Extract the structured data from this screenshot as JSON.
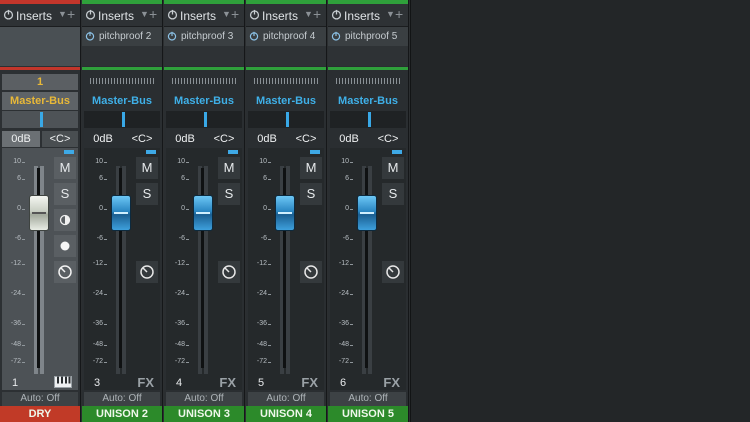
{
  "inserts_label": "Inserts",
  "channels": [
    {
      "insert_plugin": "",
      "channel_number_badge": "1",
      "bus": "Master-Bus",
      "volume": "0dB",
      "pan": "<C>",
      "mute": "M",
      "solo": "S",
      "channel_index": "1",
      "automation": "Auto: Off",
      "name": "DRY",
      "color": "#c13a27"
    },
    {
      "insert_plugin": "pitchproof 2",
      "bus": "Master-Bus",
      "volume": "0dB",
      "pan": "<C>",
      "mute": "M",
      "solo": "S",
      "channel_index": "3",
      "fx": "FX",
      "automation": "Auto: Off",
      "name": "UNISON 2",
      "color": "#2c8a2a"
    },
    {
      "insert_plugin": "pitchproof 3",
      "bus": "Master-Bus",
      "volume": "0dB",
      "pan": "<C>",
      "mute": "M",
      "solo": "S",
      "channel_index": "4",
      "fx": "FX",
      "automation": "Auto: Off",
      "name": "UNISON 3",
      "color": "#2c8a2a"
    },
    {
      "insert_plugin": "pitchproof 4",
      "bus": "Master-Bus",
      "volume": "0dB",
      "pan": "<C>",
      "mute": "M",
      "solo": "S",
      "channel_index": "5",
      "fx": "FX",
      "automation": "Auto: Off",
      "name": "UNISON 4",
      "color": "#2c8a2a"
    },
    {
      "insert_plugin": "pitchproof 5",
      "bus": "Master-Bus",
      "volume": "0dB",
      "pan": "<C>",
      "mute": "M",
      "solo": "S",
      "channel_index": "6",
      "fx": "FX",
      "automation": "Auto: Off",
      "name": "UNISON 5",
      "color": "#2c8a2a"
    }
  ],
  "meter_scale": [
    "10",
    "6",
    "0",
    "-6",
    "-12",
    "-24",
    "-36",
    "-48",
    "-72"
  ],
  "colors": {
    "accent_blue": "#3fb0e8",
    "bus_gold": "#e8b838",
    "green": "#2fa03b",
    "red": "#c3362b"
  }
}
